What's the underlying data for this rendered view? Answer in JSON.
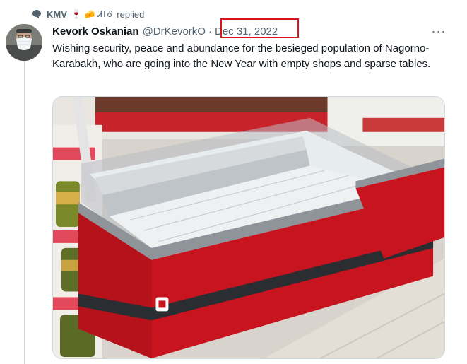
{
  "reply_context": {
    "name": "KMV",
    "emojis": "🍷 🧀 ᏗᎢᎴ",
    "action": "replied"
  },
  "tweet": {
    "author_name": "Kevork Oskanian",
    "handle": "@DrKevorkO",
    "separator": "·",
    "date": "Dec 31, 2022",
    "text": "Wishing security, peace and abundance for the besieged population of Nagorno-Karabakh, who are going into the New Year with empty shops and sparse tables.",
    "more_label": "···"
  },
  "colors": {
    "highlight_box": "#d9141c",
    "secondary_text": "#536471",
    "thread_line": "#cfd9de"
  }
}
